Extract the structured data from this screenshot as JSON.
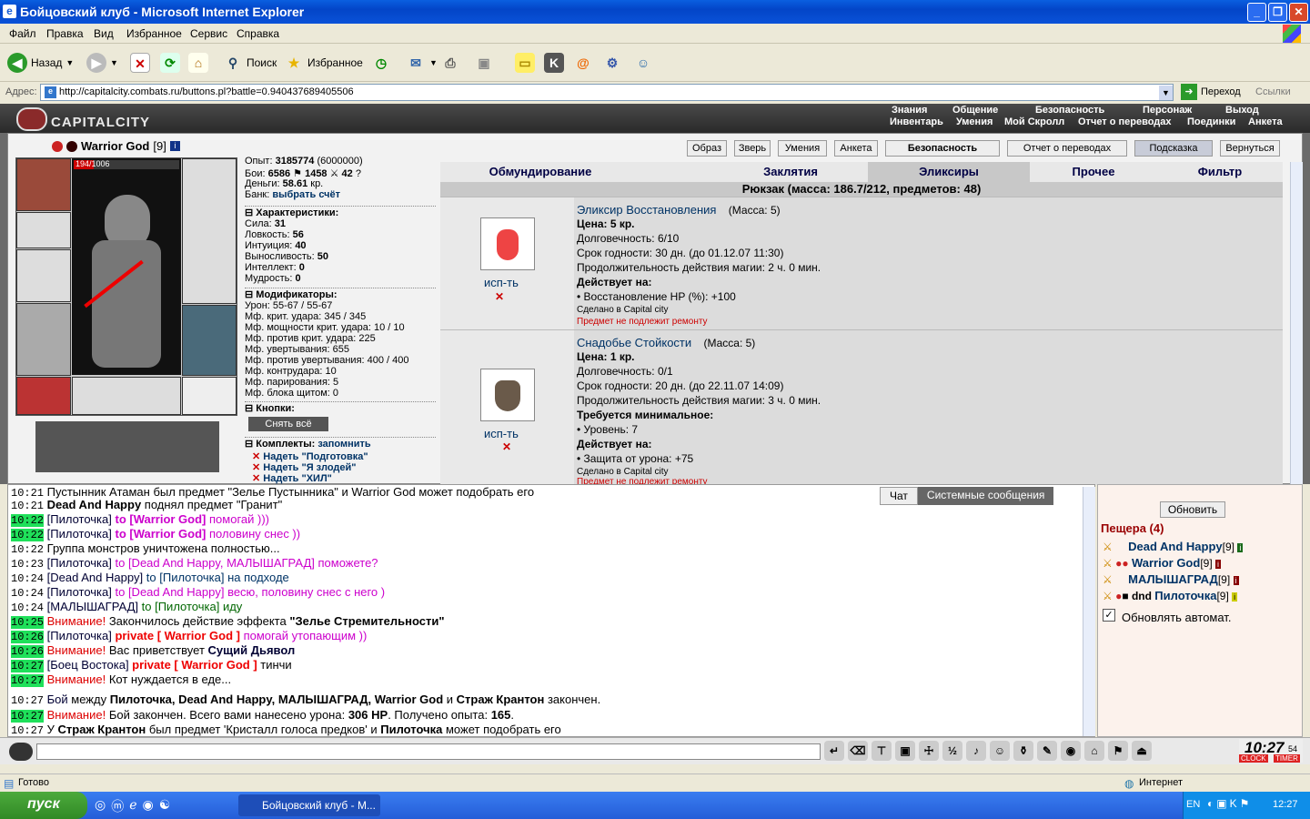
{
  "window": {
    "title": "Бойцовский клуб - Microsoft Internet Explorer"
  },
  "menu": [
    "Файл",
    "Правка",
    "Вид",
    "Избранное",
    "Сервис",
    "Справка"
  ],
  "toolbar": {
    "back": "Назад",
    "search": "Поиск",
    "favorites": "Избранное"
  },
  "address": {
    "label": "Адрес:",
    "url": "http://capitalcity.combats.ru/buttons.pl?battle=0.940437689405506",
    "go": "Переход",
    "links": "Ссылки"
  },
  "game": {
    "logo": "CAPITALCITY",
    "nav_top": [
      "Знания",
      "Общение",
      "Безопасность",
      "Персонаж",
      "Выход"
    ],
    "nav_sub": [
      "Инвентарь",
      "Умения",
      "Мой Скролл",
      "Отчет о переводах",
      "Поединки",
      "Анкета"
    ],
    "char": {
      "name": "Warrior God",
      "level": "[9]",
      "hp": "194/1006"
    },
    "stats": {
      "exp_label": "Опыт:",
      "exp": "3185774",
      "exp_next": "(6000000)",
      "fights_label": "Бои:",
      "wins": "6586",
      "losses": "1458",
      "draws": "42",
      "money_label": "Деньги:",
      "money": "58.61",
      "money_unit": "кр.",
      "bank_label": "Банк:",
      "bank": "выбрать счёт"
    },
    "chars_head": "Характеристики:",
    "chars": [
      "Сила: ",
      "31",
      "Ловкость: ",
      "56",
      "Интуиция: ",
      "40",
      "Выносливость: ",
      "50",
      "Интеллект: ",
      "0",
      "Мудрость: ",
      "0"
    ],
    "mods_head": "Модификаторы:",
    "mods": [
      "Урон: 55-67 / 55-67",
      "Мф. крит. удара: 345 / 345",
      "Мф. мощности крит. удара: 10 / 10",
      "Мф. против крит. удара: 225",
      "Мф. увертывания: 655",
      "Мф. против увертывания: 400 / 400",
      "Мф. контрудара: 10",
      "Мф. парирования: 5",
      "Мф. блока щитом: 0"
    ],
    "buttons_head": "Кнопки:",
    "undress": "Снять всё",
    "sets_head": "Комплекты:",
    "remember": "запомнить",
    "sets": [
      "Надеть \"Подготовка\"",
      "Надеть \"Я злодей\"",
      "Надеть \"ХИЛ\""
    ],
    "top_buttons": [
      "Образ",
      "Зверь",
      "Умения",
      "Анкета",
      "Безопасность",
      "Отчет о переводах",
      "Подсказка",
      "Вернуться"
    ],
    "tabs": [
      "Обмундирование",
      "Заклятия",
      "Эликсиры",
      "Прочее",
      "Фильтр"
    ],
    "backpack": "Рюкзак (масса: 186.7/212, предметов: 48)",
    "items": [
      {
        "name": "Эликсир Восстановления",
        "mass": "(Масса: 5)",
        "price": "Цена: 5 кр.",
        "dur": "Долговечность: 6/10",
        "exp": "Срок годности: 30 дн. (до 01.12.07 11:30)",
        "magic": "Продолжительность действия магии: 2 ч. 0 мин.",
        "acts": "Действует на:",
        "bullet": "• Восстановление HP (%): +100",
        "made": "Сделано в Capital city",
        "norepair": "Предмет не подлежит ремонту",
        "use": "исп-ть"
      },
      {
        "name": "Снадобье Стойкости",
        "mass": "(Масса: 5)",
        "price": "Цена: 1 кр.",
        "dur": "Долговечность: 0/1",
        "exp": "Срок годности: 20 дн. (до 22.11.07 14:09)",
        "magic": "Продолжительность действия магии: 3 ч. 0 мин.",
        "req": "Требуется минимальное:",
        "req_bullet": "• Уровень: 7",
        "acts": "Действует на:",
        "bullet": "• Защита от урона: +75",
        "made": "Сделано в Capital city",
        "norepair": "Предмет не подлежит ремонту",
        "use": "исп-ть"
      }
    ]
  },
  "chat": {
    "tabs": [
      "Чат",
      "Системные сообщения"
    ],
    "lines": [
      {
        "t": "10:21",
        "parts": [
          [
            "Пустынник Атаман был предмет \"Зелье Пустынника\" и Warrior God может подобрать его",
            "#000"
          ]
        ],
        "g": false
      },
      {
        "t": "10:21",
        "parts": [
          [
            "Dead And Happy",
            "#000",
            "b"
          ],
          [
            " поднял предмет \"Гранит\"",
            "#000"
          ]
        ],
        "g": false
      },
      {
        "t": "10:22",
        "parts": [
          [
            "[Пилоточка]",
            "#003",
            "u"
          ],
          [
            " to [Warrior God]",
            "#c0c",
            "b"
          ],
          [
            " помогай )))",
            "#c0c"
          ]
        ],
        "g": true
      },
      {
        "t": "10:22",
        "parts": [
          [
            "[Пилоточка]",
            "#003",
            "u"
          ],
          [
            " to [Warrior God]",
            "#c0c",
            "b"
          ],
          [
            " половину снес ))",
            "#c0c"
          ]
        ],
        "g": true
      },
      {
        "t": "10:22",
        "parts": [
          [
            "Группа монстров уничтожена полностью...",
            "#000"
          ]
        ],
        "g": false
      },
      {
        "t": "10:23",
        "parts": [
          [
            "[Пилоточка]",
            "#003",
            "u"
          ],
          [
            " to [Dead And Happy, МАЛЫШАГРАД] поможете?",
            "#c0c"
          ]
        ],
        "g": false
      },
      {
        "t": "10:24",
        "parts": [
          [
            "[Dead And Happy]",
            "#003"
          ],
          [
            " to [Пилоточка] на подходе",
            "#036"
          ]
        ],
        "g": false
      },
      {
        "t": "10:24",
        "parts": [
          [
            "[Пилоточка]",
            "#003"
          ],
          [
            " to [Dead And Happy] весю, половину снес с него )",
            "#c0c"
          ]
        ],
        "g": false
      },
      {
        "t": "10:24",
        "parts": [
          [
            "[МАЛЫШАГРАД]",
            "#003"
          ],
          [
            " to [Пилоточка] иду",
            "#060"
          ]
        ],
        "g": false
      },
      {
        "t": "10:25",
        "parts": [
          [
            "Внимание!",
            "#d00"
          ],
          [
            " Закончилось действие эффекта ",
            "#000"
          ],
          [
            "\"Зелье Стремительности\"",
            "#000",
            "b"
          ]
        ],
        "g": true
      },
      {
        "t": "10:26",
        "parts": [
          [
            "[Пилоточка]",
            "#003"
          ],
          [
            " private [ Warrior God ]",
            "#e00",
            "b"
          ],
          [
            " помогай утопающим ))",
            "#c0c"
          ]
        ],
        "g": true
      },
      {
        "t": "10:26",
        "parts": [
          [
            "Внимание!",
            "#d00"
          ],
          [
            " Вас приветствует ",
            "#000"
          ],
          [
            "Сущий Дьявол",
            "#003",
            "b"
          ]
        ],
        "g": true
      },
      {
        "t": "10:27",
        "parts": [
          [
            "[Боец Востока]",
            "#003"
          ],
          [
            " private [ Warrior God ]",
            "#e00",
            "b"
          ],
          [
            " тинчи",
            "#000"
          ]
        ],
        "g": true
      },
      {
        "t": "10:27",
        "parts": [
          [
            "Внимание!",
            "#d00"
          ],
          [
            " Кот нуждается в еде...",
            "#000"
          ]
        ],
        "g": true
      },
      {
        "t": "10:27",
        "parts": [
          [
            "Бой",
            "#003"
          ],
          [
            " между ",
            "#000"
          ],
          [
            "Пилоточка, Dead And Happy, МАЛЫШАГРАД, Warrior God",
            "#000",
            "b"
          ],
          [
            " и ",
            "#000"
          ],
          [
            "Страж Крантон",
            "#000",
            "b"
          ],
          [
            " закончен.",
            "#000"
          ]
        ],
        "g": false
      },
      {
        "t": "10:27",
        "parts": [
          [
            "Внимание!",
            "#d00"
          ],
          [
            " Бой закончен. Всего вами нанесено урона: ",
            "#000"
          ],
          [
            "306 HP",
            "#000",
            "b"
          ],
          [
            ". Получено опыта: ",
            "#000"
          ],
          [
            "165",
            "#000",
            "b"
          ],
          [
            ".",
            "#000"
          ]
        ],
        "g": true
      },
      {
        "t": "10:27",
        "parts": [
          [
            "У ",
            "#000"
          ],
          [
            "Страж Крантон",
            "#000",
            "b"
          ],
          [
            " был предмет 'Кристалл голоса предков' и ",
            "#000"
          ],
          [
            "Пилоточка",
            "#000",
            "b"
          ],
          [
            " может подобрать его",
            "#000"
          ]
        ],
        "g": false
      }
    ]
  },
  "users": {
    "refresh": "Обновить",
    "location": "Пещера (4)",
    "list": [
      {
        "name": "Dead And Happy",
        "lvl": "[9]"
      },
      {
        "name": "Warrior God",
        "lvl": "[9]"
      },
      {
        "name": "МАЛЫШАГРАД",
        "lvl": "[9]"
      },
      {
        "name": "Пилоточка",
        "lvl": "[9]",
        "pre": "dnd"
      }
    ],
    "auto": "Обновлять автомат."
  },
  "clock": {
    "time": "10:27",
    "sec": "54",
    "label1": "CLOCK",
    "label2": "TIMER"
  },
  "status": {
    "ready": "Готово",
    "zone": "Интернет"
  },
  "taskbar": {
    "start": "пуск",
    "task": "Бойцовский клуб - M...",
    "lang": "EN",
    "time": "12:27"
  },
  "colors": {
    "accent": "#0345c8",
    "green": "#1fe05a",
    "link": "#0a2a6a"
  }
}
